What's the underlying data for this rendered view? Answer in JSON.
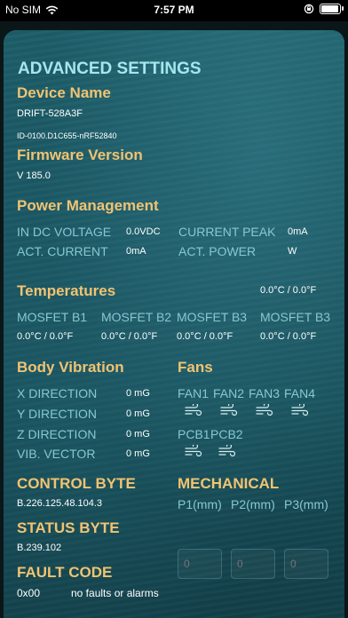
{
  "status_bar": {
    "carrier": "No SIM",
    "time": "7:57 PM"
  },
  "title": "ADVANCED SETTINGS",
  "device": {
    "heading": "Device Name",
    "name": "DRIFT-528A3F",
    "id": "ID-0100.D1C655-nRF52840"
  },
  "firmware": {
    "heading": "Firmware Version",
    "value": "V  185.0"
  },
  "power": {
    "heading": "Power Management",
    "in_dc_label": "IN DC VOLTAGE",
    "in_dc_value": "0.0VDC",
    "current_peak_label": "CURRENT PEAK",
    "current_peak_value": "0mA",
    "act_current_label": "ACT. CURRENT",
    "act_current_value": "0mA",
    "act_power_label": "ACT. POWER",
    "act_power_value": "W"
  },
  "temperatures": {
    "heading": "Temperatures",
    "summary": "0.0°C  /  0.0°F",
    "mosfets": [
      {
        "label": "MOSFET B1",
        "value": "0.0°C  /  0.0°F"
      },
      {
        "label": "MOSFET B2",
        "value": "0.0°C  /  0.0°F"
      },
      {
        "label": "MOSFET B3",
        "value": "0.0°C  /  0.0°F"
      },
      {
        "label": "MOSFET B3",
        "value": "0.0°C  /  0.0°F"
      }
    ]
  },
  "vibration": {
    "heading": "Body Vibration",
    "rows": [
      {
        "label": "X DIRECTION",
        "value": "0 mG"
      },
      {
        "label": "Y DIRECTION",
        "value": "0 mG"
      },
      {
        "label": "Z DIRECTION",
        "value": "0 mG"
      },
      {
        "label": "VIB. VECTOR",
        "value": "0 mG"
      }
    ]
  },
  "fans": {
    "heading": "Fans",
    "labels": [
      "FAN1",
      "FAN2",
      "FAN3",
      "FAN4"
    ],
    "pcb_labels": [
      "PCB1",
      "PCB2"
    ],
    "icon": "wind-icon"
  },
  "control_byte": {
    "heading": "CONTROL BYTE",
    "value": "B.226.125.48.104.3"
  },
  "mechanical": {
    "heading": "MECHANICAL",
    "labels": [
      "P1(mm)",
      "P2(mm)",
      "P3(mm)"
    ],
    "inputs": [
      "0",
      "0",
      "0"
    ]
  },
  "status_byte": {
    "heading": "STATUS BYTE",
    "value": "B.239.102"
  },
  "fault_code": {
    "heading": "FAULT CODE",
    "code": "0x00",
    "message": "no  faults  or  alarms"
  }
}
